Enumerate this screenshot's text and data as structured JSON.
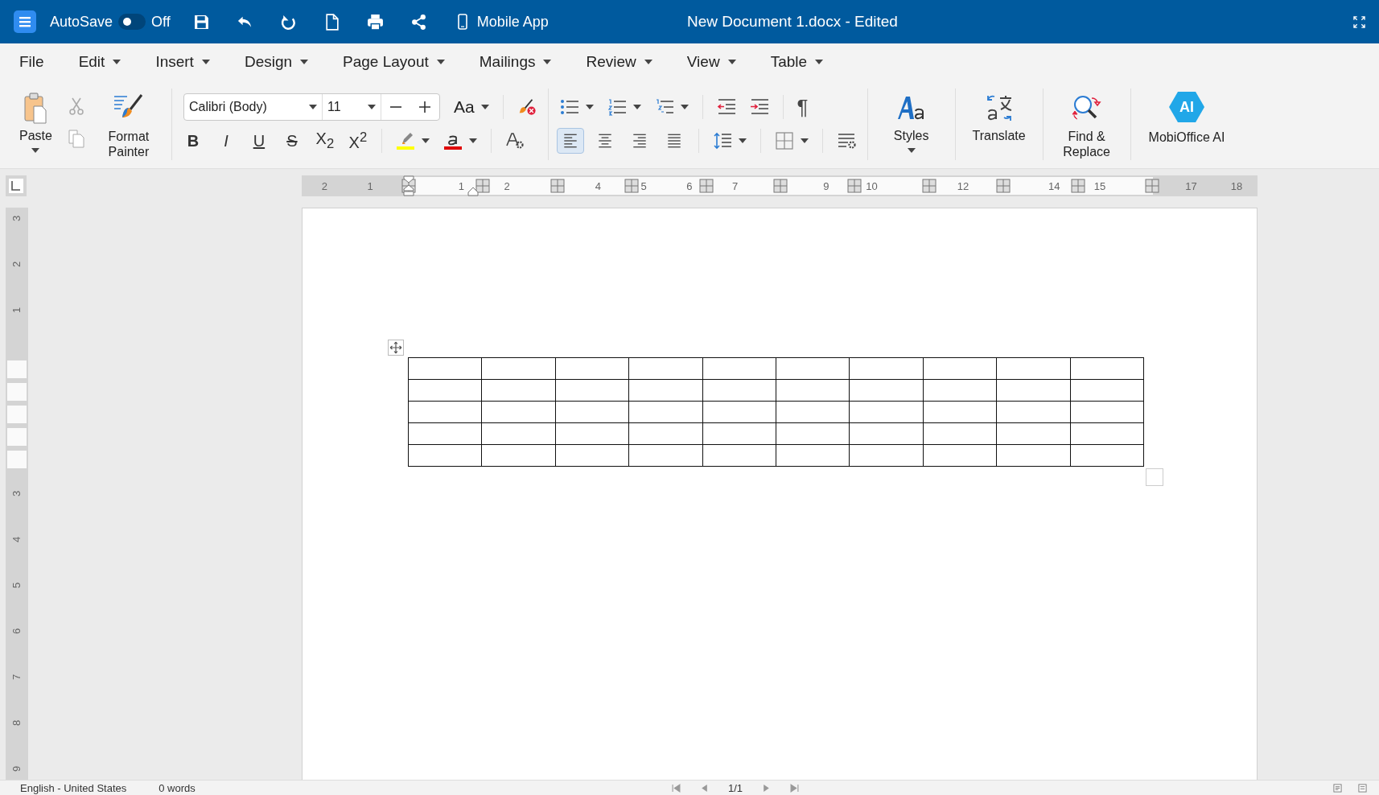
{
  "app_bar": {
    "autosave_label": "AutoSave",
    "autosave": {
      "on": false,
      "label": "Off"
    },
    "mobile_app": "Mobile App",
    "title": "New Document 1.docx - Edited"
  },
  "menu": [
    {
      "label": "File",
      "dropdown": false
    },
    {
      "label": "Edit",
      "dropdown": true
    },
    {
      "label": "Insert",
      "dropdown": true
    },
    {
      "label": "Design",
      "dropdown": true
    },
    {
      "label": "Page Layout",
      "dropdown": true
    },
    {
      "label": "Mailings",
      "dropdown": true
    },
    {
      "label": "Review",
      "dropdown": true
    },
    {
      "label": "View",
      "dropdown": true
    },
    {
      "label": "Table",
      "dropdown": true
    }
  ],
  "ribbon": {
    "paste": "Paste",
    "format_painter": "Format Painter",
    "font": "Calibri (Body)",
    "size": "11",
    "change_case": "Aa",
    "format_buttons": [
      {
        "kind": "bold",
        "label": "B"
      },
      {
        "kind": "italic",
        "label": "I"
      },
      {
        "kind": "underline",
        "label": "U"
      },
      {
        "kind": "strike",
        "label": "S"
      },
      {
        "kind": "sub",
        "label": "X$_{2}$"
      },
      {
        "kind": "sup",
        "label": "X$^{2}$"
      }
    ],
    "alignment": [
      {
        "kind": "left",
        "selected": true
      },
      {
        "kind": "center",
        "selected": false
      },
      {
        "kind": "right",
        "selected": false
      },
      {
        "kind": "justify",
        "selected": false
      }
    ],
    "pilcrow": "¶",
    "styles": "Styles",
    "translate": "Translate",
    "find_replace": "Find & Replace",
    "ai_badge": "AI",
    "ai": "MobiOffice AI"
  },
  "ruler": {
    "horizontal": [
      {
        "kind": "number",
        "label": "2"
      },
      {
        "kind": "number",
        "label": "1"
      },
      {
        "kind": "hidden"
      },
      {
        "kind": "number",
        "label": "1"
      },
      {
        "kind": "number",
        "label": "2"
      },
      {
        "kind": "hidden"
      },
      {
        "kind": "number",
        "label": "4"
      },
      {
        "kind": "number",
        "label": "5"
      },
      {
        "kind": "number",
        "label": "6"
      },
      {
        "kind": "number",
        "label": "7"
      },
      {
        "kind": "hidden"
      },
      {
        "kind": "number",
        "label": "9"
      },
      {
        "kind": "number",
        "label": "10"
      },
      {
        "kind": "hidden"
      },
      {
        "kind": "number",
        "label": "12"
      },
      {
        "kind": "hidden"
      },
      {
        "kind": "number",
        "label": "14"
      },
      {
        "kind": "number",
        "label": "15"
      },
      {
        "kind": "hidden"
      },
      {
        "kind": "number",
        "label": "17"
      },
      {
        "kind": "number",
        "label": "18"
      }
    ],
    "vertical": [
      {
        "kind": "number",
        "label": "3"
      },
      {
        "kind": "number",
        "label": "2"
      },
      {
        "kind": "number",
        "label": "1"
      },
      {
        "kind": "hidden"
      },
      {
        "kind": "hidden"
      },
      {
        "kind": "hidden"
      },
      {
        "kind": "number",
        "label": "3"
      },
      {
        "kind": "number",
        "label": "4"
      },
      {
        "kind": "number",
        "label": "5"
      },
      {
        "kind": "number",
        "label": "6"
      },
      {
        "kind": "number",
        "label": "7"
      },
      {
        "kind": "number",
        "label": "8"
      },
      {
        "kind": "number",
        "label": "9"
      }
    ]
  },
  "table": {
    "rows": [
      {
        "cells": [
          {
            "kind": "empty"
          },
          {
            "kind": "empty"
          },
          {
            "kind": "empty"
          },
          {
            "kind": "empty"
          },
          {
            "kind": "empty"
          },
          {
            "kind": "empty"
          },
          {
            "kind": "empty"
          },
          {
            "kind": "empty"
          },
          {
            "kind": "empty"
          },
          {
            "kind": "empty"
          }
        ]
      },
      {
        "cells": [
          {
            "kind": "empty"
          },
          {
            "kind": "empty"
          },
          {
            "kind": "empty"
          },
          {
            "kind": "empty"
          },
          {
            "kind": "empty"
          },
          {
            "kind": "empty"
          },
          {
            "kind": "empty"
          },
          {
            "kind": "empty"
          },
          {
            "kind": "empty"
          },
          {
            "kind": "empty"
          }
        ]
      },
      {
        "cells": [
          {
            "kind": "empty"
          },
          {
            "kind": "empty"
          },
          {
            "kind": "empty"
          },
          {
            "kind": "empty"
          },
          {
            "kind": "empty"
          },
          {
            "kind": "empty"
          },
          {
            "kind": "empty"
          },
          {
            "kind": "empty"
          },
          {
            "kind": "empty"
          },
          {
            "kind": "empty"
          }
        ]
      },
      {
        "cells": [
          {
            "kind": "empty"
          },
          {
            "kind": "empty"
          },
          {
            "kind": "empty"
          },
          {
            "kind": "empty"
          },
          {
            "kind": "empty"
          },
          {
            "kind": "empty"
          },
          {
            "kind": "empty"
          },
          {
            "kind": "empty"
          },
          {
            "kind": "empty"
          },
          {
            "kind": "empty"
          }
        ]
      },
      {
        "cells": [
          {
            "kind": "empty"
          },
          {
            "kind": "empty"
          },
          {
            "kind": "empty"
          },
          {
            "kind": "empty"
          },
          {
            "kind": "empty"
          },
          {
            "kind": "empty"
          },
          {
            "kind": "empty"
          },
          {
            "kind": "empty"
          },
          {
            "kind": "empty"
          },
          {
            "kind": "empty"
          }
        ]
      }
    ]
  },
  "status_bar": {
    "language": "English - United States",
    "words": "0 words",
    "page": "1/1"
  }
}
